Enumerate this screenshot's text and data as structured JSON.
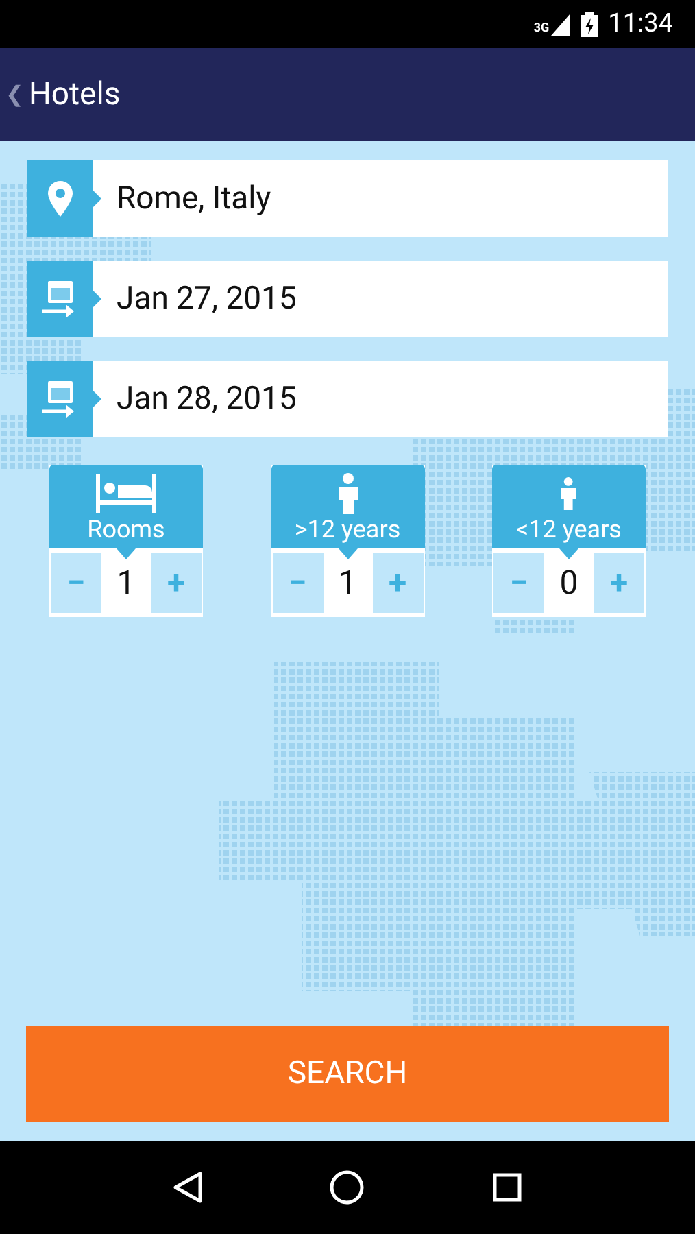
{
  "status_bar": {
    "network": "3G",
    "time": "11:34"
  },
  "app_bar": {
    "back": "❮",
    "title": "Hotels"
  },
  "fields": [
    {
      "kind": "location",
      "value": "Rome, Italy"
    },
    {
      "kind": "date",
      "value": "Jan 27, 2015"
    },
    {
      "kind": "date",
      "value": "Jan 28, 2015"
    }
  ],
  "counters": [
    {
      "kind": "bed",
      "label": "Rooms",
      "minus": "−",
      "value": "1",
      "plus": "+"
    },
    {
      "kind": "adult",
      "label": ">12 years",
      "minus": "−",
      "value": "1",
      "plus": "+"
    },
    {
      "kind": "child",
      "label": "<12 years",
      "minus": "−",
      "value": "0",
      "plus": "+"
    }
  ],
  "search_button": "SEARCH"
}
